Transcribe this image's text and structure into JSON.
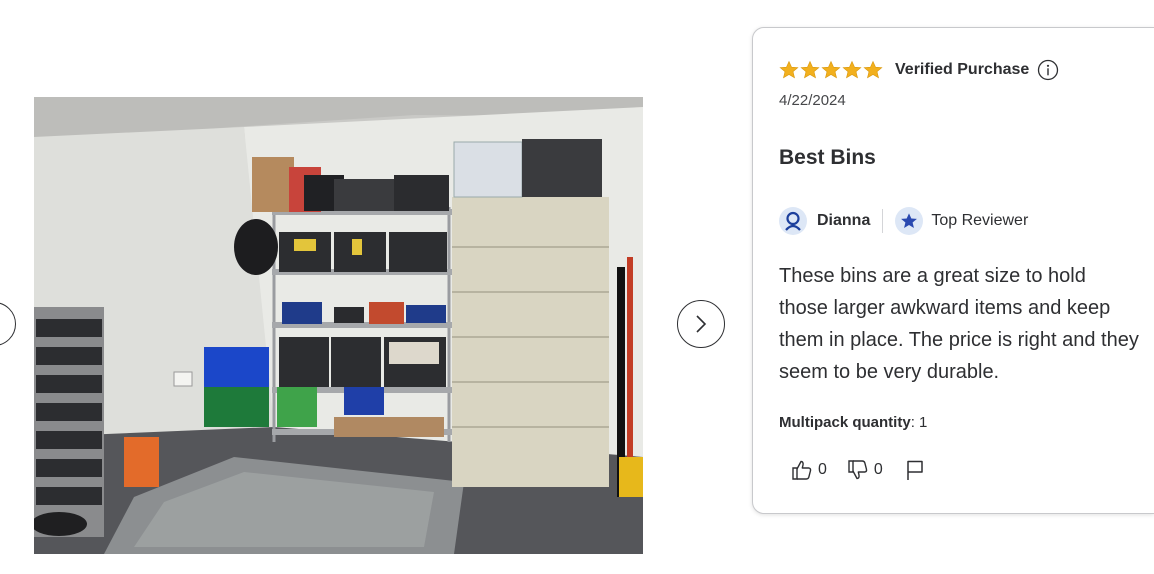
{
  "review": {
    "rating": 5,
    "rating_max": 5,
    "verified_label": "Verified Purchase",
    "date": "4/22/2024",
    "title": "Best Bins",
    "reviewer_name": "Dianna",
    "reviewer_badge": "Top Reviewer",
    "body": "These bins are a great size to hold those larger awkward items and keep them in place. The price is right and they seem to be very durable.",
    "multipack_label": "Multipack quantity",
    "multipack_value": ": 1",
    "helpful_count": "0",
    "unhelpful_count": "0"
  },
  "icons": {
    "star": "star-filled-icon",
    "info": "info-circle-icon",
    "user": "user-icon",
    "badge": "star-badge-icon",
    "next": "chevron-right-icon",
    "prev": "chevron-left-icon",
    "thumbs_up": "thumbs-up-icon",
    "thumbs_down": "thumbs-down-icon",
    "flag": "flag-icon"
  },
  "colors": {
    "star": "#f2b01e",
    "badge_blue": "#2a49b0",
    "text": "#2e2f32",
    "border": "#c8c9cc"
  }
}
